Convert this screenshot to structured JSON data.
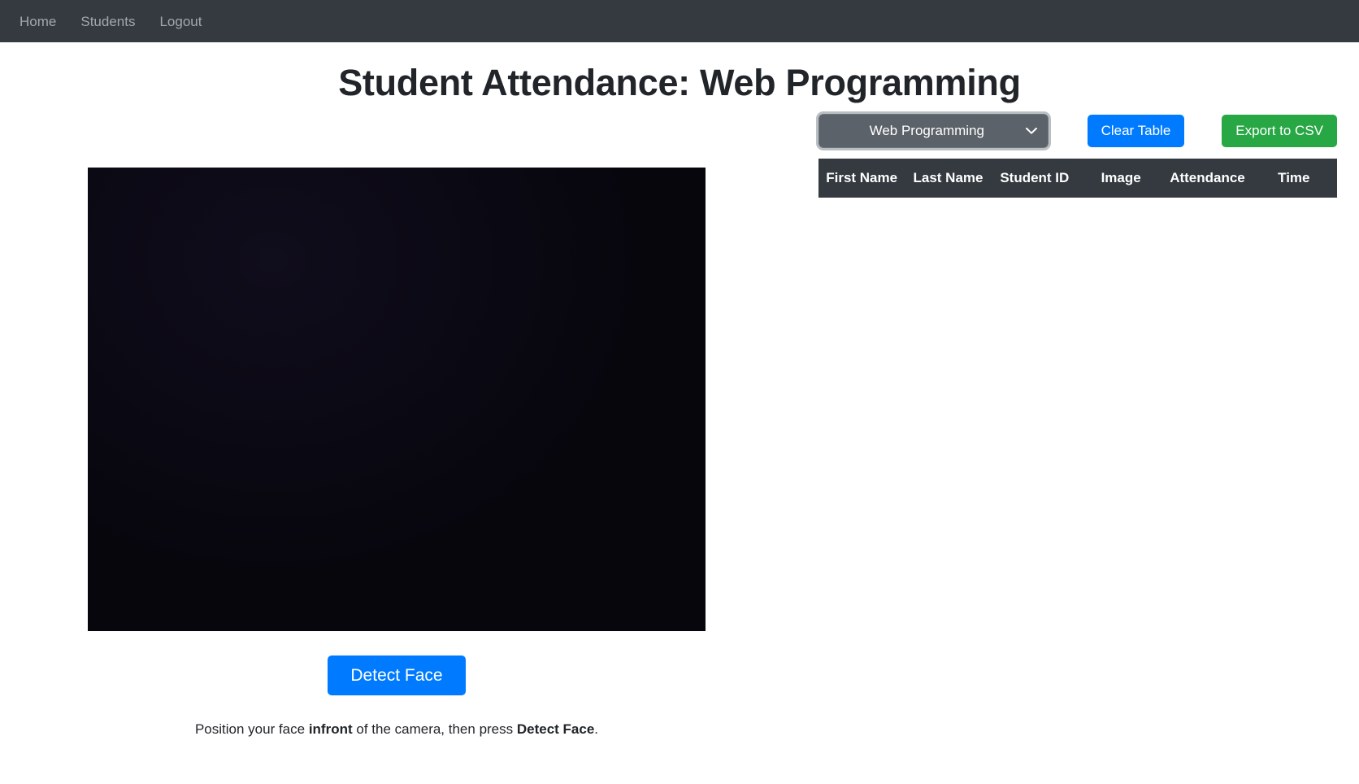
{
  "navbar": {
    "links": [
      {
        "label": "Home",
        "name": "nav-link-home"
      },
      {
        "label": "Students",
        "name": "nav-link-students"
      },
      {
        "label": "Logout",
        "name": "nav-link-logout"
      }
    ],
    "background_color": "#343a40"
  },
  "header": {
    "title": "Student Attendance: Web Programming"
  },
  "camera": {
    "video_label": "camera-video-feed",
    "detect_button_label": "Detect Face",
    "hint_prefix": "Position your face ",
    "hint_bold_1": "infront",
    "hint_middle": " of the camera, then press ",
    "hint_bold_2": "Detect Face",
    "hint_suffix": "."
  },
  "controls": {
    "course_select_value": "Web Programming",
    "course_select_options": [
      "Web Programming"
    ],
    "chevron_icon": "chevron-down-icon",
    "clear_table_label": "Clear Table",
    "export_csv_label": "Export to CSV",
    "clear_color": "#007bff",
    "export_color": "#28a745",
    "select_color": "#5c6269"
  },
  "table": {
    "columns": [
      "First Name",
      "Last Name",
      "Student ID",
      "Image",
      "Attendance",
      "Time"
    ],
    "rows": [],
    "header_background": "#343a40"
  }
}
